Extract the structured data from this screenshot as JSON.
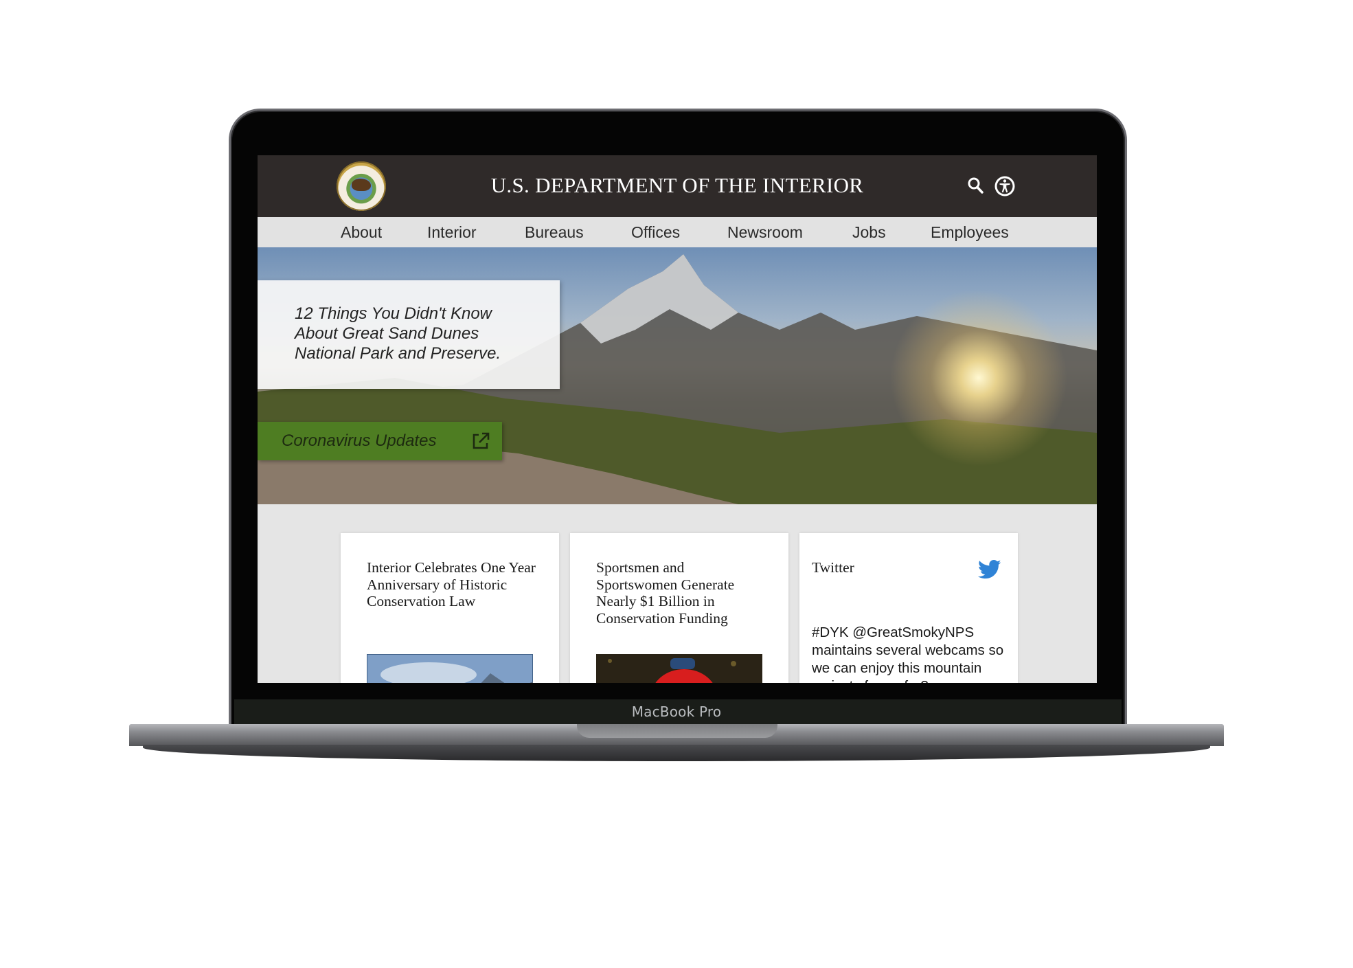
{
  "device": {
    "label": "MacBook Pro"
  },
  "header": {
    "title": "U.S. DEPARTMENT OF THE INTERIOR"
  },
  "nav": {
    "items": [
      "About",
      "Interior",
      "Bureaus",
      "Offices",
      "Newsroom",
      "Jobs",
      "Employees"
    ]
  },
  "hero": {
    "feature_line1": "12 Things You Didn't Know",
    "feature_line2": "About Great Sand Dunes",
    "feature_line3": "National Park and Preserve.",
    "cta_label": "Coronavirus Updates"
  },
  "cards": [
    {
      "title": "Interior Celebrates One Year Anniversary of Historic Conservation Law"
    },
    {
      "title": "Sportsmen and Sportswomen Generate Nearly $1 Billion in Conservation Funding"
    }
  ],
  "twitter": {
    "title": "Twitter",
    "tweet": "#DYK @GreatSmokyNPS maintains several webcams so we can enjoy this mountain majesty from afar?"
  },
  "colors": {
    "header_bg": "#2f2a29",
    "nav_bg": "#e2e2e2",
    "cta_green": "#4e7d22",
    "twitter_blue": "#2f83d6"
  },
  "icons": [
    "seal-logo",
    "search-icon",
    "accessibility-icon",
    "external-link-icon",
    "twitter-bird-icon"
  ]
}
